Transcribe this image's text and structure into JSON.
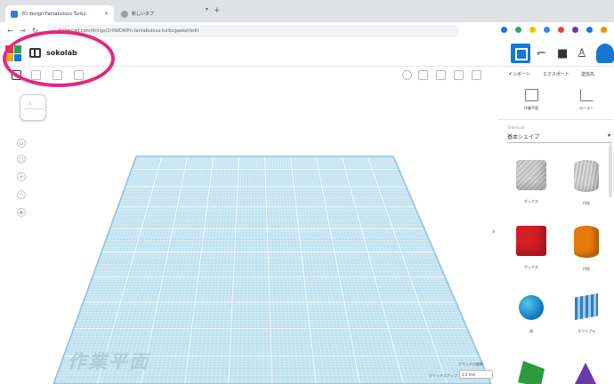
{
  "browser": {
    "tabs": [
      {
        "title": "3D design Fantabulous Turbu",
        "active": true
      },
      {
        "title": "新しいタブ",
        "active": false
      }
    ],
    "url": "tinkercad.com/things/2rXWDWPn-fantabulous-turbugasket/edit",
    "extension_colors": [
      "#1a73e8",
      "#34a853",
      "#fbbc04",
      "#4285f4",
      "#ea4335",
      "#673ab7",
      "#1a73e8",
      "#fb8c00"
    ]
  },
  "app": {
    "design_name": "sokolab",
    "logo_colors": [
      "#e63c2f",
      "#2fa04c",
      "#f4a52a",
      "#1477d1"
    ],
    "header_actions": {
      "import": "インポート",
      "export": "エクスポート",
      "share": "送信先"
    },
    "panel_tools": {
      "workplane": "作業平面",
      "ruler": "ルーラー"
    },
    "accent_color": "#1477d1"
  },
  "shapes_panel": {
    "category_caption": "Tinkercad",
    "category": "基本シェイプ",
    "shapes": [
      {
        "label": "ボックス",
        "icon": "box-striped"
      },
      {
        "label": "円柱",
        "icon": "cylinder-striped"
      },
      {
        "label": "ボックス",
        "icon": "box-red"
      },
      {
        "label": "円柱",
        "icon": "cylinder-orange"
      },
      {
        "label": "球",
        "icon": "sphere-blue"
      },
      {
        "label": "スクリブル",
        "icon": "scribble"
      }
    ]
  },
  "workplane": {
    "label": "作業平面",
    "settings_label": "グリッドの編集",
    "snap_label": "グリッドスナップ",
    "snap_value": "1.0 mm",
    "grid_color": "#bfe0ee"
  },
  "viewcube": {
    "face_label": "上"
  },
  "annotation": {
    "ring_color": "#e6267f"
  }
}
